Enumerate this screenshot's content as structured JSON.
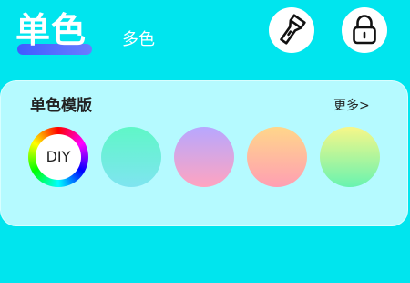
{
  "tabs": {
    "single": "单色",
    "multi": "多色"
  },
  "toolbar": {
    "flashlight_icon": "flashlight-icon",
    "lock_icon": "lock-icon"
  },
  "templates": {
    "title": "单色模版",
    "more": "更多>",
    "diy_label": "DIY",
    "swatches": [
      {
        "name": "mint-cyan",
        "top": "#5ff7c7",
        "bottom": "#7fe4f0"
      },
      {
        "name": "lavender-pink",
        "top": "#b7a7ff",
        "bottom": "#ffa4c0"
      },
      {
        "name": "peach-pink",
        "top": "#ffd68a",
        "bottom": "#ff9fb3"
      },
      {
        "name": "lime-mint",
        "top": "#f7f788",
        "bottom": "#68f3b0"
      }
    ]
  },
  "colors": {
    "background": "#00e5ee",
    "panel": "#b5faff",
    "tab_underline": "#3f5cff",
    "text_dark": "#222222",
    "text_light": "#ffffff"
  }
}
